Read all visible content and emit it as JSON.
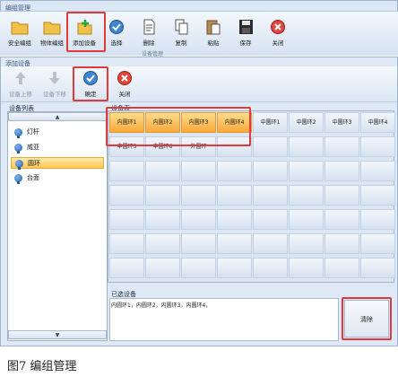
{
  "window1": {
    "title": "编组管理",
    "toolbar": [
      {
        "label": "安全编组",
        "icon": "folder-icon"
      },
      {
        "label": "物体编组",
        "icon": "folder-icon"
      },
      {
        "label": "添加设备",
        "icon": "add-device-icon"
      },
      {
        "label": "选择",
        "icon": "select-globe-icon"
      },
      {
        "label": "删除",
        "icon": "delete-doc-icon"
      },
      {
        "label": "复制",
        "icon": "copy-icon"
      },
      {
        "label": "粘贴",
        "icon": "paste-icon"
      },
      {
        "label": "保存",
        "icon": "save-icon"
      },
      {
        "label": "关闭",
        "icon": "close-icon"
      }
    ],
    "group_label": "设备管理"
  },
  "window2": {
    "title": "添加设备",
    "toolbar": [
      {
        "label": "设备上移",
        "icon": "arrow-up-icon"
      },
      {
        "label": "设备下移",
        "icon": "arrow-down-icon"
      },
      {
        "label": "确定",
        "icon": "confirm-globe-icon"
      },
      {
        "label": "关闭",
        "icon": "close-icon"
      }
    ]
  },
  "device_list": {
    "title": "设备列表",
    "scroll_up": "▲",
    "scroll_down": "▼",
    "items": [
      {
        "label": "灯杆",
        "selected": false
      },
      {
        "label": "威亚",
        "selected": false
      },
      {
        "label": "圆环",
        "selected": true
      },
      {
        "label": "台面",
        "selected": false
      }
    ]
  },
  "device_table": {
    "title": "设备表",
    "rows": [
      [
        {
          "label": "内圆环1",
          "selected": true
        },
        {
          "label": "内圆环2",
          "selected": true
        },
        {
          "label": "内圆环3",
          "selected": true
        },
        {
          "label": "内圆环4",
          "selected": true
        },
        {
          "label": "中圆环1",
          "selected": false
        },
        {
          "label": "中圆环2",
          "selected": false
        },
        {
          "label": "中圆环3",
          "selected": false
        },
        {
          "label": "中圆环4",
          "selected": false
        }
      ],
      [
        {
          "label": "中圆环5",
          "selected": false
        },
        {
          "label": "中圆环6",
          "selected": false
        },
        {
          "label": "外圆环",
          "selected": false
        },
        {
          "label": "",
          "selected": false
        },
        {
          "label": "",
          "selected": false
        },
        {
          "label": "",
          "selected": false
        },
        {
          "label": "",
          "selected": false
        },
        {
          "label": "",
          "selected": false
        }
      ]
    ],
    "empty_rows": 5
  },
  "selected_devices": {
    "label": "已选设备",
    "text": "内圆环1，内圆环2，内圆环3，内圆环4，",
    "clear_button": "清除"
  },
  "caption": "图7  编组管理",
  "colors": {
    "highlight": "#e03a3a",
    "selected_fill": "#f7a93b",
    "panel": "#dfe9f6"
  }
}
